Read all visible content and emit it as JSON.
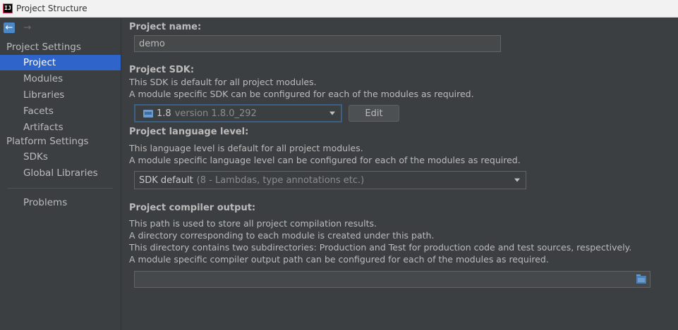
{
  "window": {
    "app_icon_text": "IJ",
    "title": "Project Structure"
  },
  "nav": {
    "back_glyph": "←",
    "forward_glyph": "→"
  },
  "sidebar": {
    "project_settings_header": "Project Settings",
    "project_settings_items": [
      {
        "label": "Project",
        "selected": true
      },
      {
        "label": "Modules"
      },
      {
        "label": "Libraries"
      },
      {
        "label": "Facets"
      },
      {
        "label": "Artifacts"
      }
    ],
    "platform_settings_header": "Platform Settings",
    "platform_settings_items": [
      {
        "label": "SDKs"
      },
      {
        "label": "Global Libraries"
      }
    ],
    "problems_label": "Problems"
  },
  "project_name": {
    "label": "Project name:",
    "value": "demo"
  },
  "project_sdk": {
    "label": "Project SDK:",
    "desc_line1": "This SDK is default for all project modules.",
    "desc_line2": "A module specific SDK can be configured for each of the modules as required.",
    "selected_name": "1.8",
    "selected_version": "version 1.8.0_292",
    "icon": "sdk-folder-icon",
    "edit_label": "Edit"
  },
  "language_level": {
    "label": "Project language level:",
    "desc_line1": "This language level is default for all project modules.",
    "desc_line2": "A module specific language level can be configured for each of the modules as required.",
    "selected_name": "SDK default",
    "selected_detail": "(8 - Lambdas, type annotations etc.)"
  },
  "compiler_output": {
    "label": "Project compiler output:",
    "desc_line1": "This path is used to store all project compilation results.",
    "desc_line2": "A directory corresponding to each module is created under this path.",
    "desc_line3": "This directory contains two subdirectories: Production and Test for production code and test sources, respectively.",
    "desc_line4": "A module specific compiler output path can be configured for each of the modules as required.",
    "value": "",
    "browse_icon": "folder-browse-icon"
  },
  "colors": {
    "background": "#3c3f41",
    "selection": "#2f65ca",
    "focus_border": "#3d6185"
  }
}
